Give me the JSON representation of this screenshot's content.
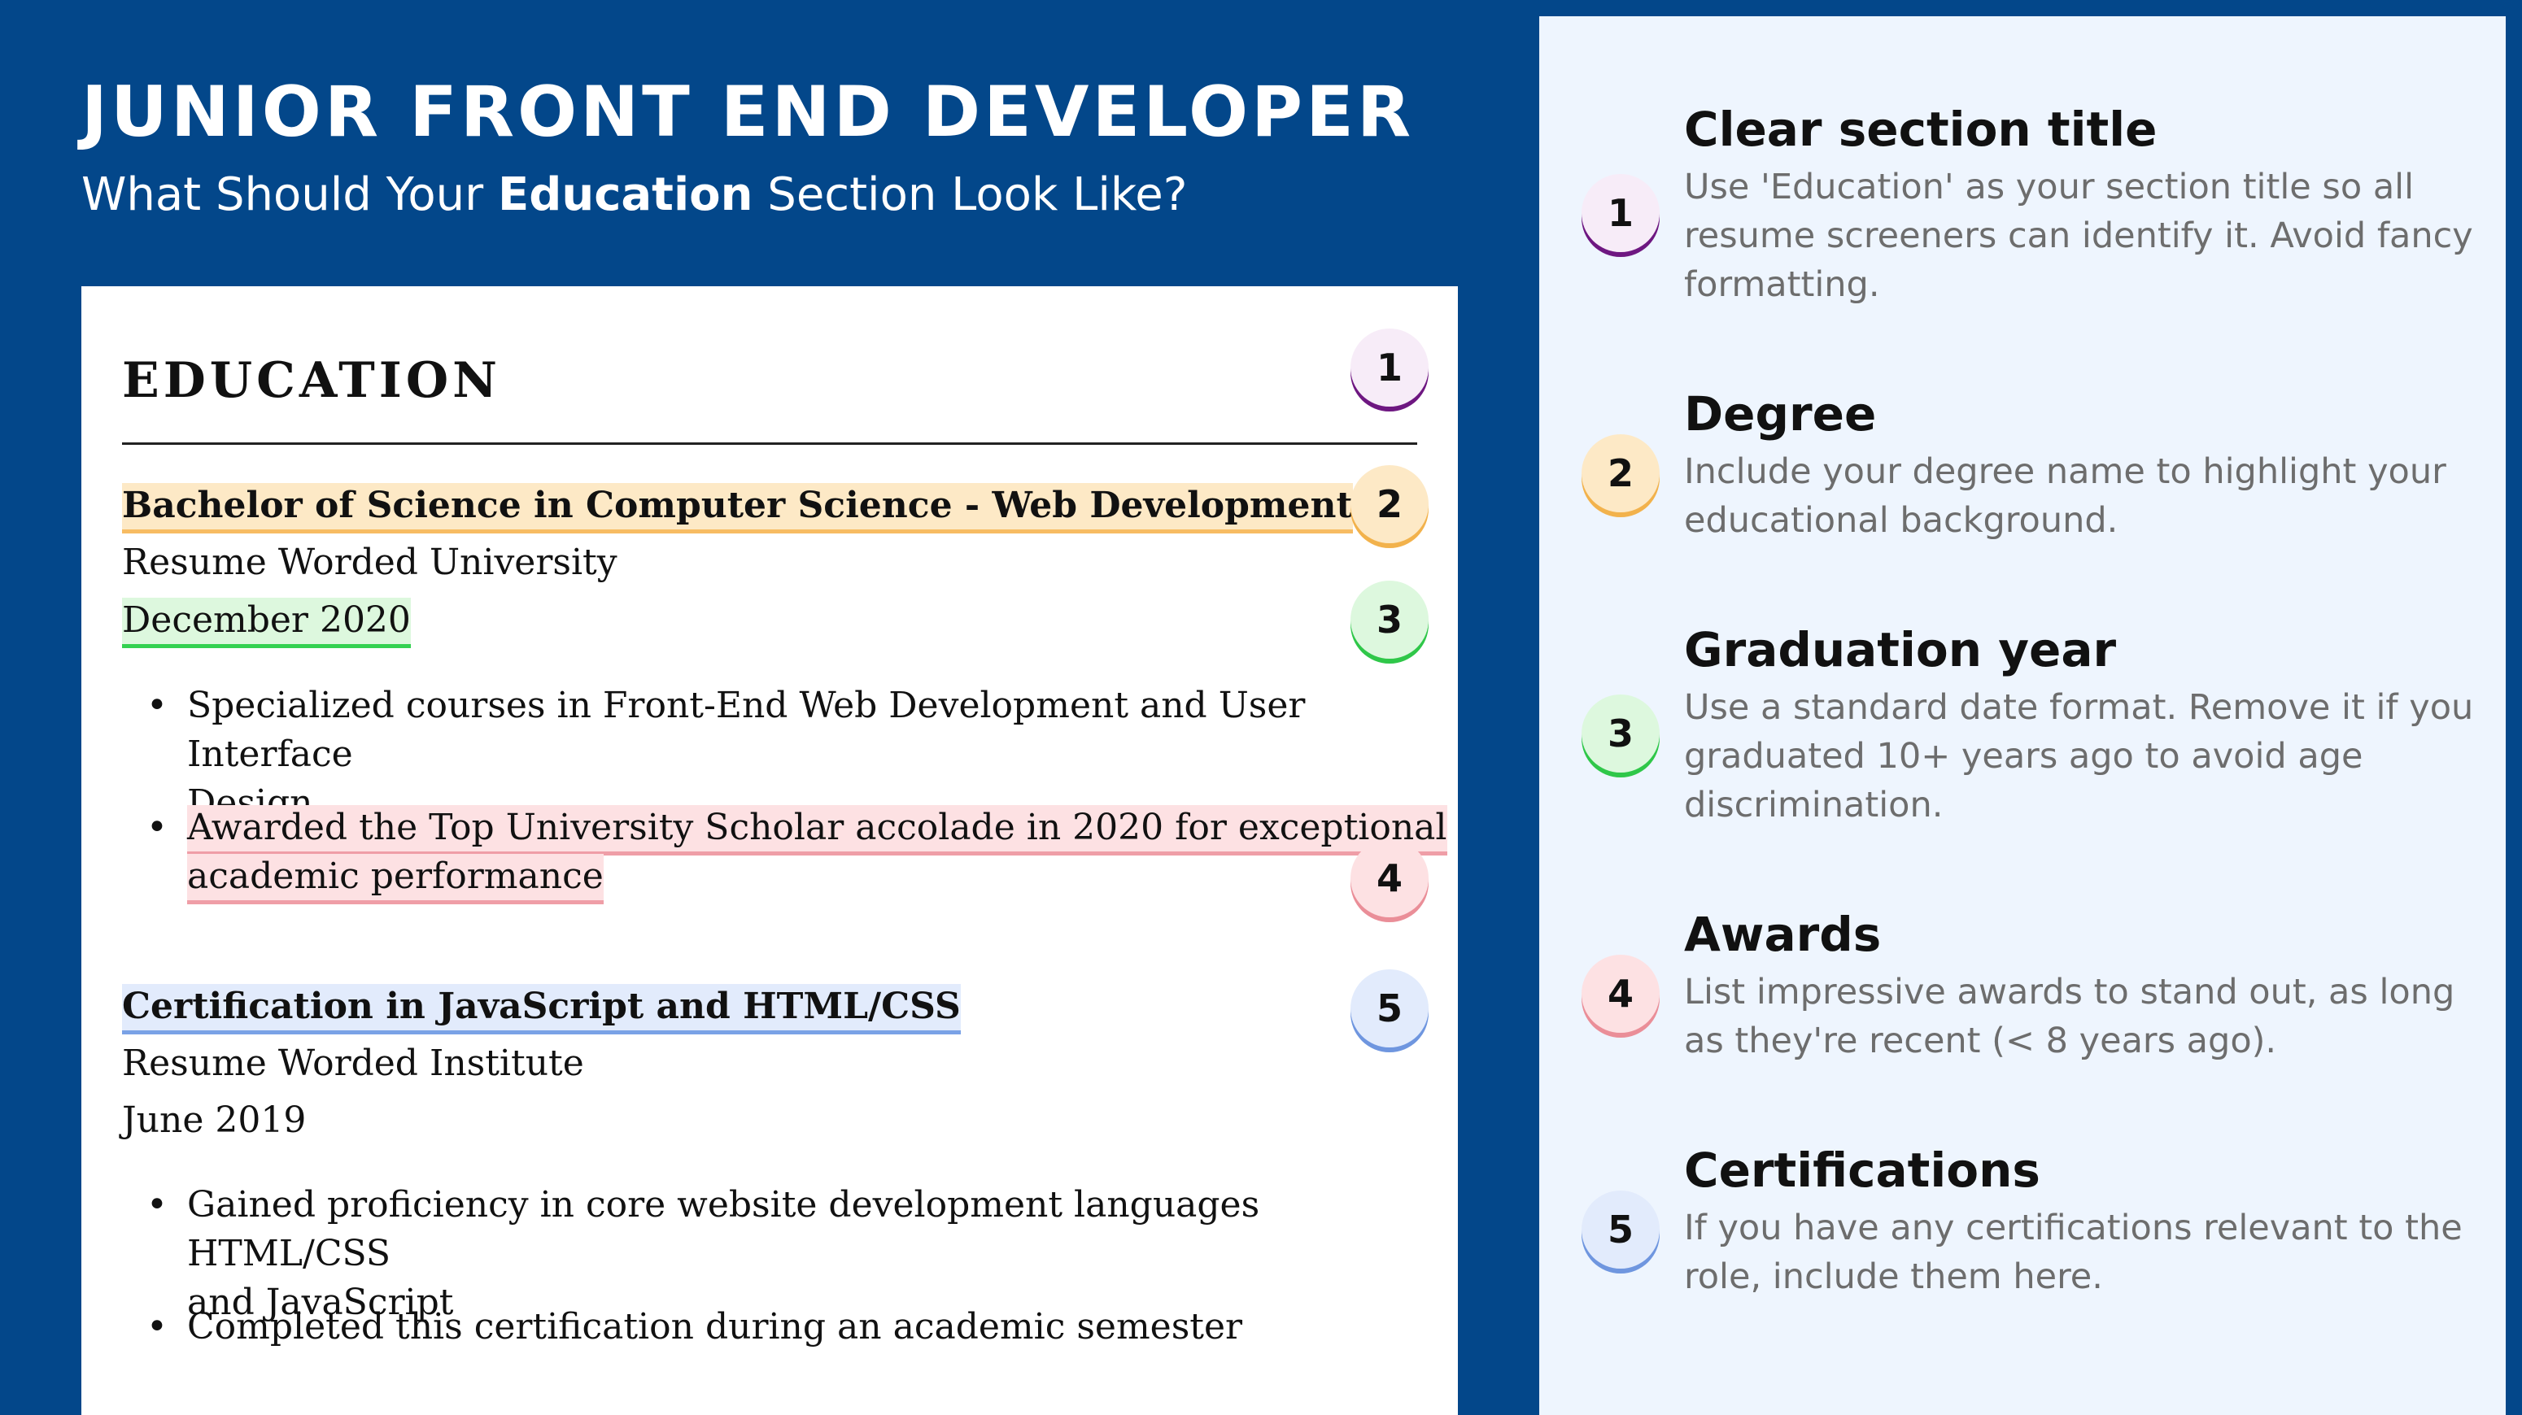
{
  "header": {
    "title": "JUNIOR FRONT END DEVELOPER",
    "subtitle_pre": "What Should Your ",
    "subtitle_bold": "Education",
    "subtitle_post": " Section Look Like?"
  },
  "resume": {
    "section_title": "EDUCATION",
    "entries": [
      {
        "degree": "Bachelor of Science in Computer Science - Web Development",
        "school": "Resume Worded University",
        "date": "December 2020",
        "bullets": [
          {
            "line1": "Specialized courses in Front-End Web Development and User Interface",
            "line2": "Design"
          },
          {
            "line1": "Awarded the Top University Scholar accolade in 2020 for exceptional",
            "line2": "academic performance"
          }
        ]
      },
      {
        "degree": "Certification in JavaScript and HTML/CSS",
        "school": "Resume Worded Institute",
        "date": "June 2019",
        "bullets": [
          {
            "line1": "Gained proficiency in core website development languages HTML/CSS",
            "line2": "and JavaScript"
          },
          {
            "line1": "Completed this certification during an academic semester",
            "line2": ""
          }
        ]
      }
    ],
    "bullet_glyph": "•"
  },
  "markers": [
    "1",
    "2",
    "3",
    "4",
    "5"
  ],
  "marker_colors": {
    "1": "#6e1781",
    "2": "#f2b24c",
    "3": "#2fc749",
    "4": "#ea8e98",
    "5": "#6f96df"
  },
  "tips": [
    {
      "number": "1",
      "title": "Clear section title",
      "desc": "Use 'Education' as your section title so all resume screeners can identify it. Avoid fancy formatting."
    },
    {
      "number": "2",
      "title": "Degree",
      "desc": "Include your degree name to highlight your educational background."
    },
    {
      "number": "3",
      "title": "Graduation year",
      "desc": "Use a standard date format. Remove it if you graduated 10+ years ago to avoid age discrimination."
    },
    {
      "number": "4",
      "title": "Awards",
      "desc": "List impressive awards to stand out, as long as they're recent (< 8 years ago)."
    },
    {
      "number": "5",
      "title": "Certifications",
      "desc": "If you have any certifications relevant to the role, include them here."
    }
  ],
  "colors": {
    "background": "#03478a",
    "card": "#ffffff",
    "tips_panel": "#eef5fe"
  }
}
